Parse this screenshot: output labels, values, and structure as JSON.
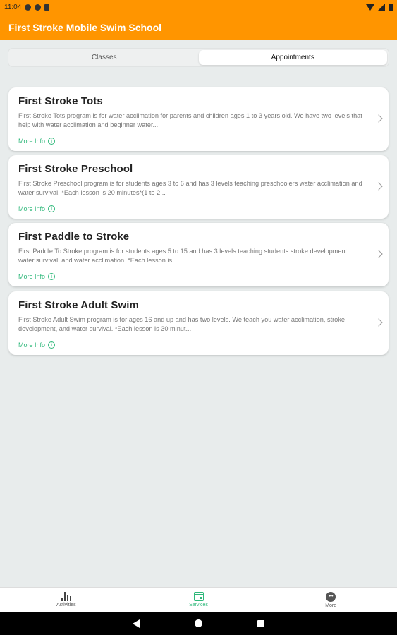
{
  "status_bar": {
    "time": "11:04"
  },
  "app_bar": {
    "title": "First Stroke Mobile Swim School"
  },
  "segments": [
    {
      "label": "Classes",
      "active": false
    },
    {
      "label": "Appointments",
      "active": true
    }
  ],
  "cards": [
    {
      "title": "First Stroke Tots",
      "description": "First Stroke Tots program is for water acclimation for parents and children ages 1 to 3 years old.  We have two levels that help with water acclimation and beginner water...",
      "more_label": "More Info"
    },
    {
      "title": "First Stroke Preschool",
      "description": "First Stroke Preschool program is for students ages 3 to 6 and has 3 levels teaching preschoolers water acclimation and water survival. *Each lesson is 20 minutes*(1 to 2...",
      "more_label": "More Info"
    },
    {
      "title": "First Paddle to Stroke",
      "description": "First Paddle To Stroke program is for students ages 5 to 15 and has 3 levels teaching students stroke development, water survival, and water acclimation. *Each lesson is ...",
      "more_label": "More Info"
    },
    {
      "title": "First Stroke Adult Swim",
      "description": "First Stroke Adult Swim program is for ages 16 and up and has two levels. We teach you water acclimation, stroke development, and water survival. *Each lesson is 30 minut...",
      "more_label": "More Info"
    }
  ],
  "bottom_nav": [
    {
      "label": "Activities",
      "icon": "bar-chart-icon",
      "active": false
    },
    {
      "label": "Services",
      "icon": "calendar-icon",
      "active": true
    },
    {
      "label": "More",
      "icon": "more-icon",
      "active": false
    }
  ],
  "colors": {
    "brand": "#ff9500",
    "accent": "#2eb87a",
    "background": "#e8ecec"
  }
}
